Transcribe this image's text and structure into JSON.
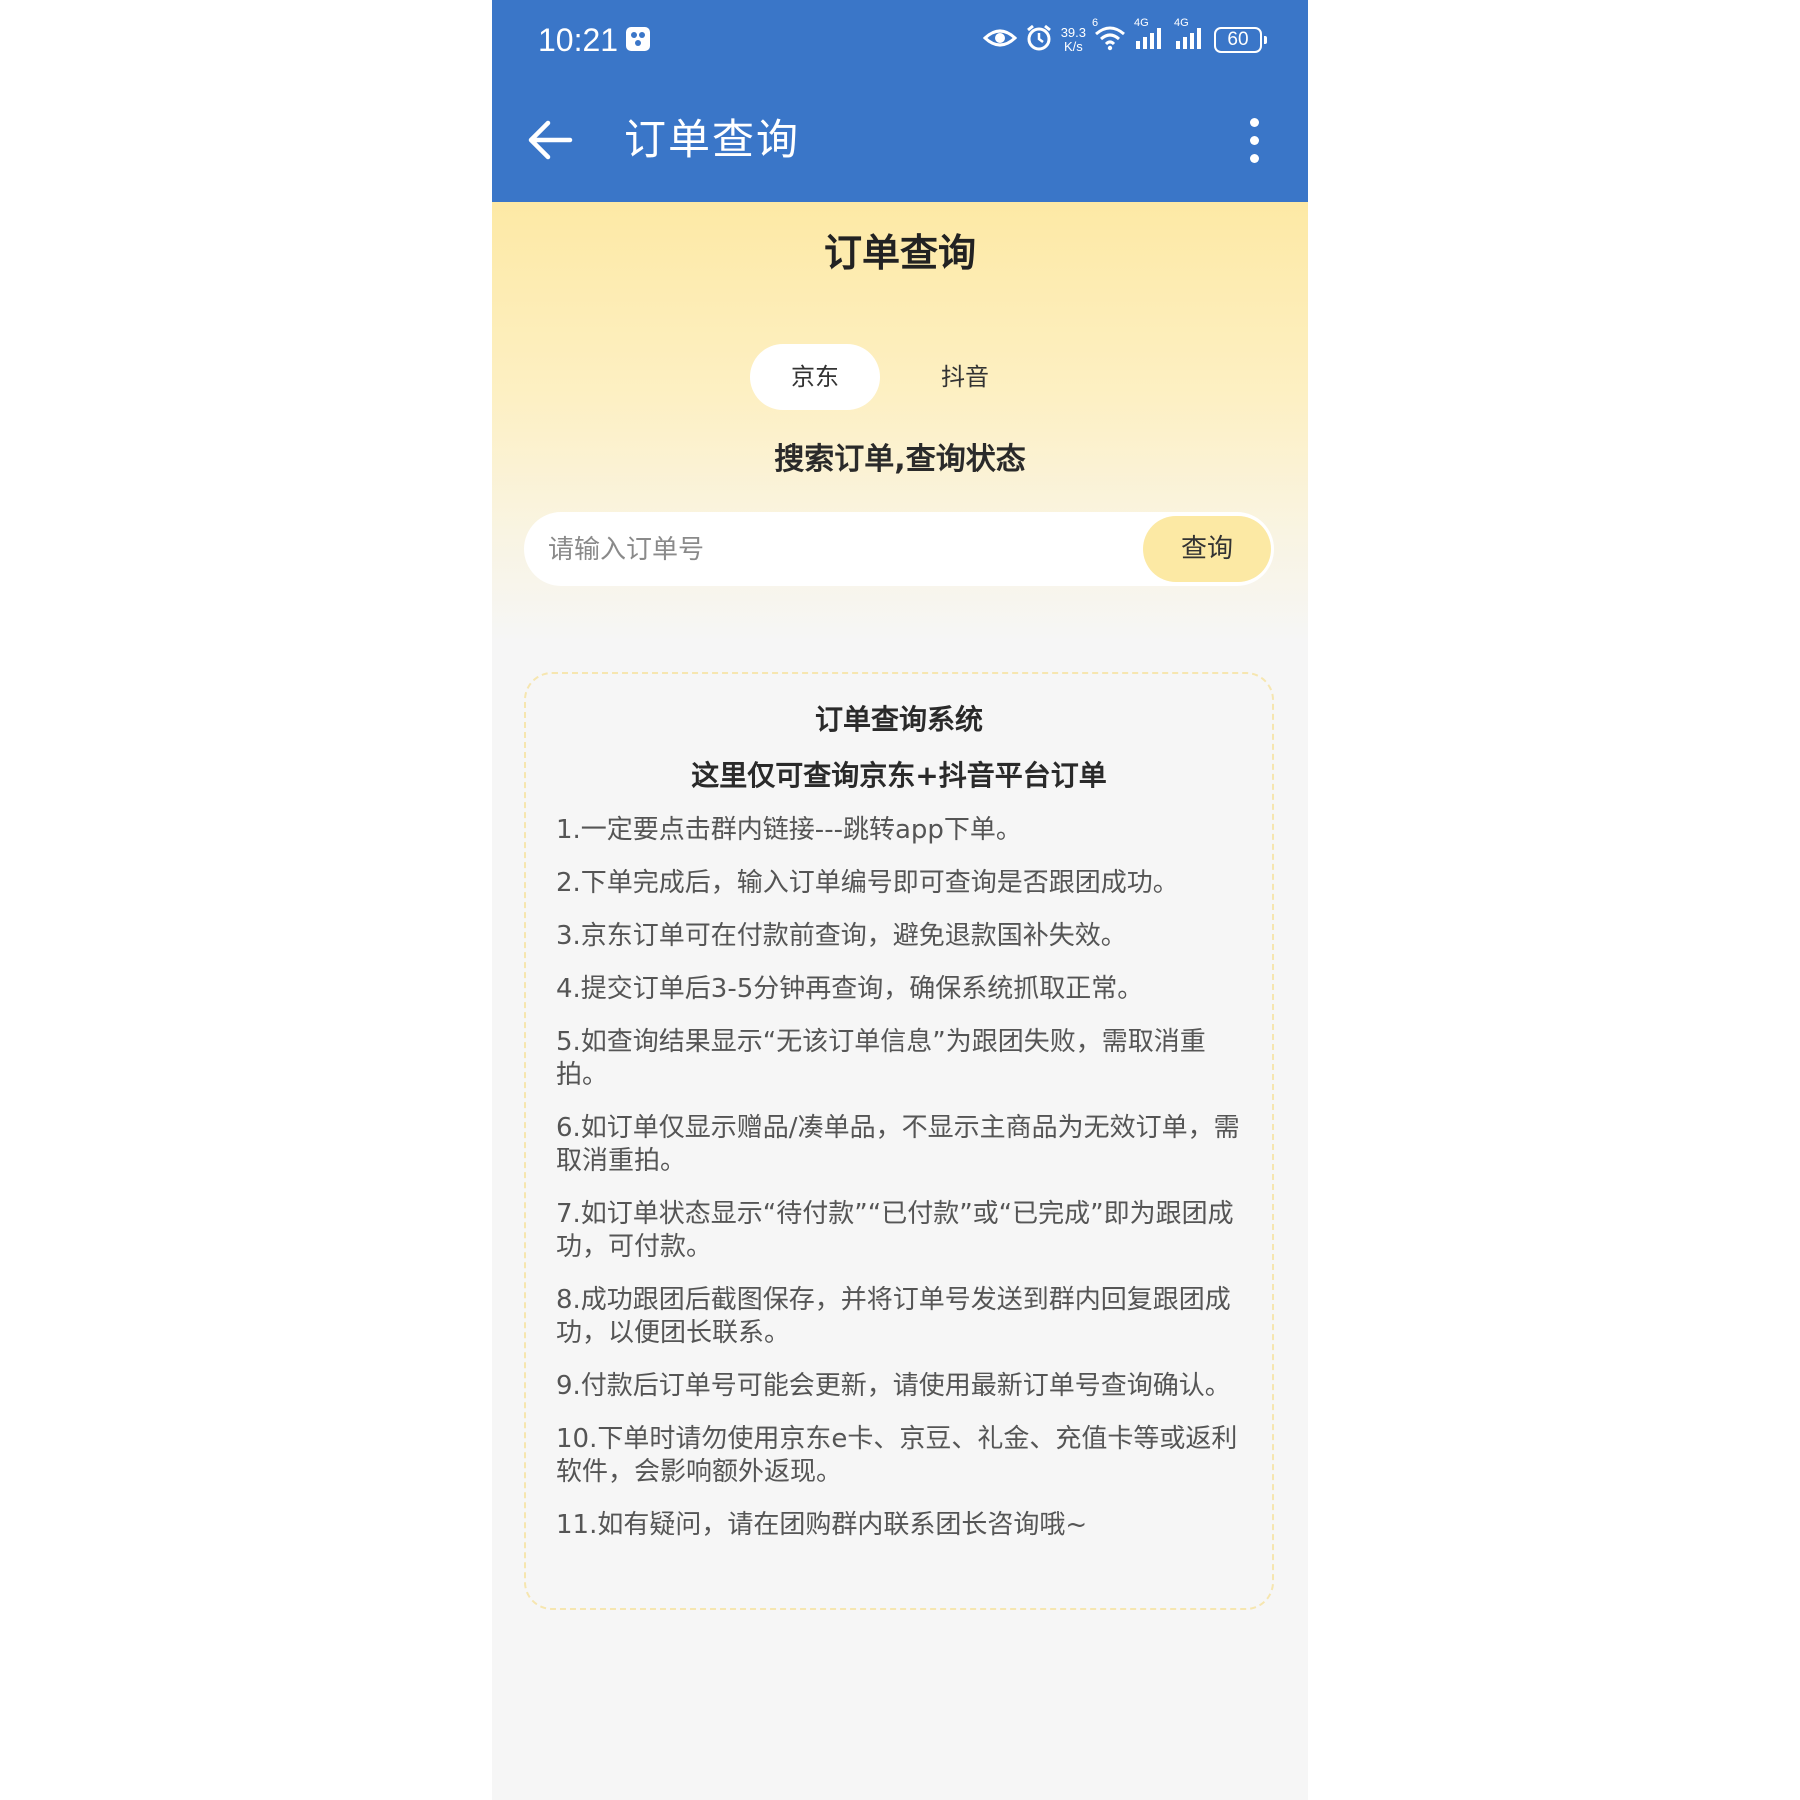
{
  "status_bar": {
    "time": "10:21",
    "net_speed_value": "39.3",
    "net_speed_unit": "K/s",
    "wifi_tag": "6",
    "sim1_tag": "4G",
    "sim2_tag": "4G",
    "battery": "60",
    "icons": [
      "app-notification-icon",
      "eye-icon",
      "alarm-icon",
      "wifi-icon",
      "signal-icon",
      "signal-icon",
      "battery-icon"
    ]
  },
  "header": {
    "title": "订单查询",
    "back_icon": "arrow-left-icon",
    "more_icon": "more-vertical-icon"
  },
  "hero": {
    "title": "订单查询",
    "tabs": [
      {
        "label": "京东",
        "active": true
      },
      {
        "label": "抖音",
        "active": false
      }
    ],
    "subtitle": "搜索订单,查询状态",
    "search": {
      "placeholder": "请输入订单号",
      "value": "",
      "button_label": "查询"
    }
  },
  "info": {
    "title": "订单查询系统",
    "subtitle": "这里仅可查询京东+抖音平台订单",
    "rules": [
      "1.一定要点击群内链接---跳转app下单。",
      "2.下单完成后，输入订单编号即可查询是否跟团成功。",
      "3.京东订单可在付款前查询，避免退款国补失效。",
      "4.提交订单后3-5分钟再查询，确保系统抓取正常。",
      "5.如查询结果显示“无该订单信息”为跟团失败，需取消重拍。",
      "6.如订单仅显示赠品/凑单品，不显示主商品为无效订单，需取消重拍。",
      "7.如订单状态显示“待付款”“已付款”或“已完成”即为跟团成功，可付款。",
      "8.成功跟团后截图保存，并将订单号发送到群内回复跟团成功，以便团长联系。",
      "9.付款后订单号可能会更新，请使用最新订单号查询确认。",
      "10.下单时请勿使用京东e卡、京豆、礼金、充值卡等或返利软件，会影响额外返现。",
      "11.如有疑问，请在团购群内联系团长咨询哦~"
    ]
  },
  "colors": {
    "header_blue": "#3a76c8",
    "hero_yellow": "#fde9a5",
    "button_yellow": "#fce9a4",
    "background": "#f6f6f6"
  }
}
